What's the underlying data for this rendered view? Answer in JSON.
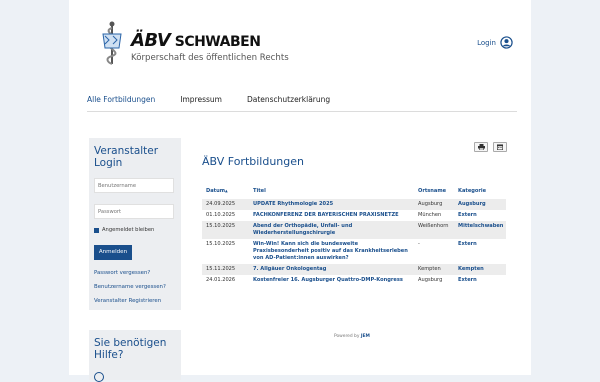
{
  "header": {
    "brand_abv": "ÄBV",
    "brand_region": "SCHWABEN",
    "tagline": "Körperschaft des öffentlichen Rechts",
    "login_label": "Login"
  },
  "nav": {
    "items": [
      "Alle Fortbildungen",
      "Impressum",
      "Datenschutzerklärung"
    ],
    "active": "Alle Fortbildungen"
  },
  "sidebar": {
    "login_title": "Veranstalter Login",
    "username_placeholder": "Benutzername",
    "password_placeholder": "Passwort",
    "remember_label": "Angemeldet bleiben",
    "remember_checked": true,
    "submit_label": "Anmelden",
    "links": [
      "Passwort vergessen?",
      "Benutzername vergessen?",
      "Veranstalter Registrieren"
    ],
    "help_title": "Sie benötigen Hilfe?"
  },
  "main": {
    "title": "ÄBV Fortbildungen",
    "print_icon": "printer-icon",
    "calendar_icon": "calendar-icon",
    "columns": [
      "Datum",
      "Titel",
      "Ortsname",
      "Kategorie"
    ],
    "sort_indicator": "▲",
    "rows": [
      {
        "date": "24.09.2025",
        "title": "UPDATE Rhythmologie 2025",
        "ort": "Augsburg",
        "cat": "Augsburg"
      },
      {
        "date": "01.10.2025",
        "title": "FACHKONFERENZ DER BAYERISCHEN PRAXISNETZE",
        "ort": "München",
        "cat": "Extern"
      },
      {
        "date": "15.10.2025",
        "title": "Abend der Orthopädie, Unfall- und Wiederherstellungschirurgie",
        "ort": "Weißenhorn",
        "cat": "Mittelschwaben"
      },
      {
        "date": "15.10.2025",
        "title": "Win-Win! Kann sich die bundesweite Praxisbesonderheit positiv auf das Krankheitserleben von AD-Patient:innen auswirken?",
        "ort": "-",
        "cat": "Extern"
      },
      {
        "date": "15.11.2025",
        "title": "7. Allgäuer Onkologentag",
        "ort": "Kempten",
        "cat": "Kempten"
      },
      {
        "date": "24.01.2026",
        "title": "Kostenfreier 16. Augsburger Quattro-DMP-Kongress",
        "ort": "Augsburg",
        "cat": "Extern"
      }
    ],
    "powered_prefix": "Powered by",
    "powered_brand": "JEM"
  },
  "colors": {
    "accent": "#1a4f8c",
    "background": "#edf1f6",
    "row_stripe": "#ececec"
  }
}
